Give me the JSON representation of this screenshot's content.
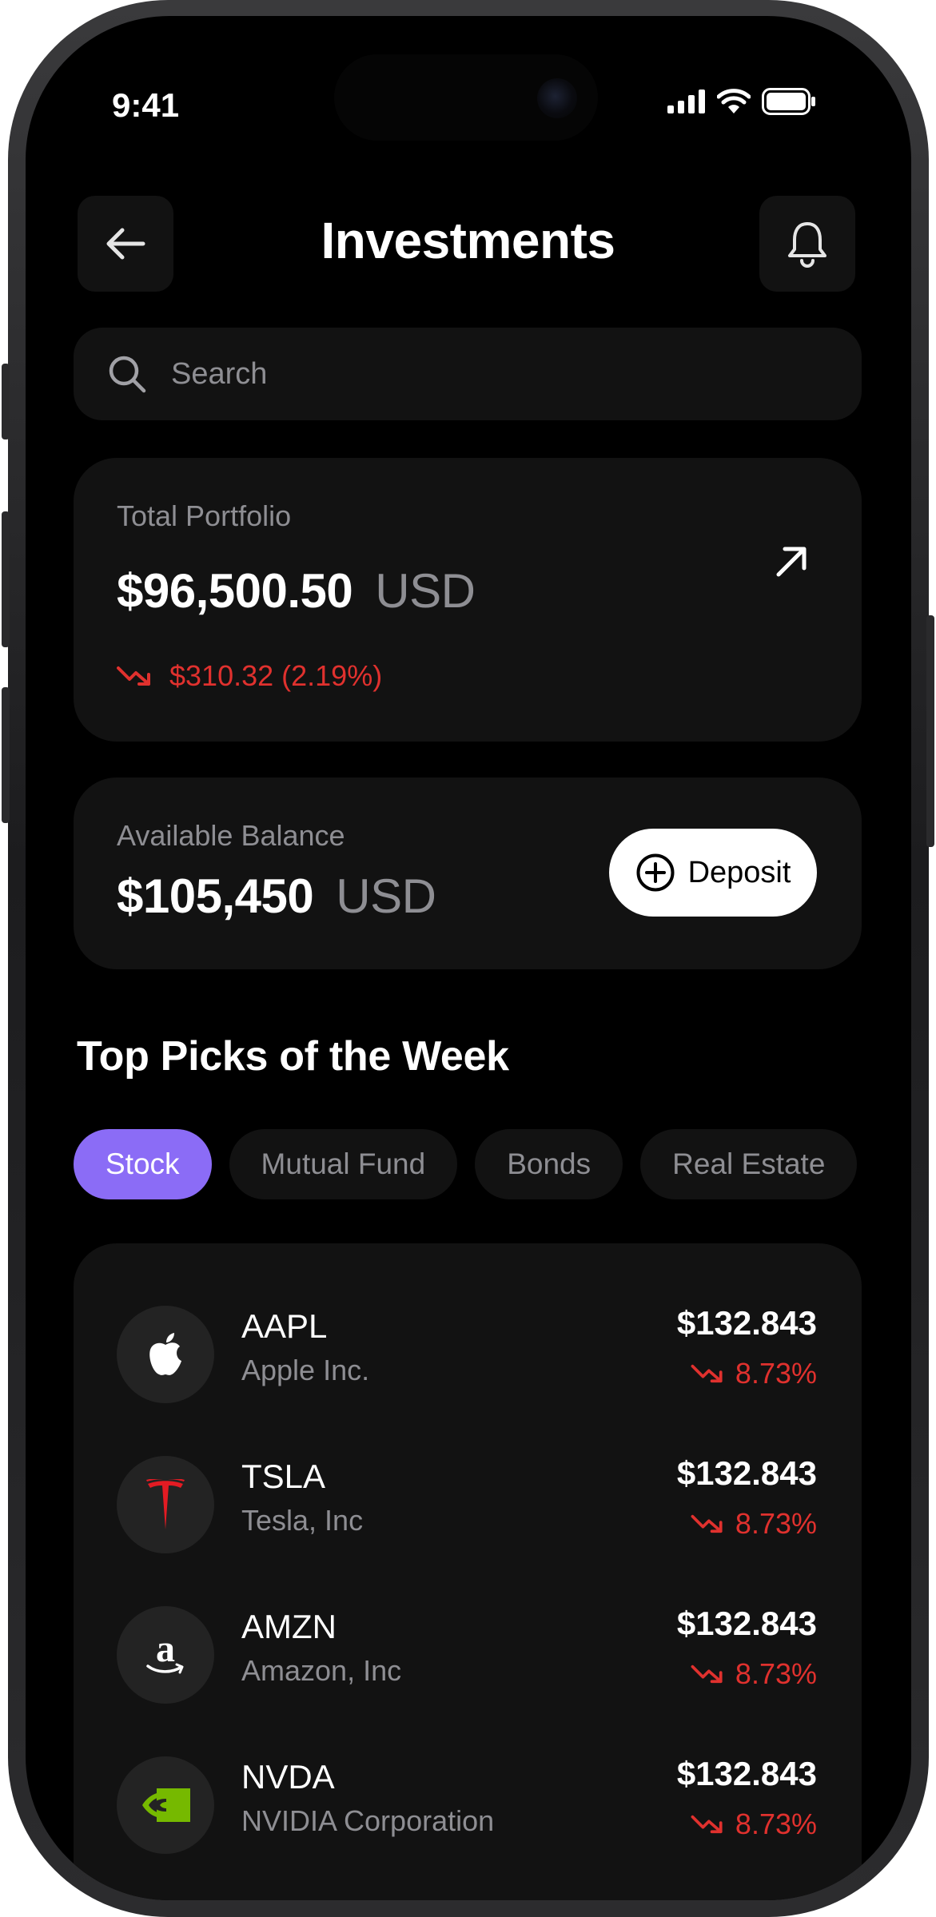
{
  "status": {
    "time": "9:41"
  },
  "header": {
    "title": "Investments"
  },
  "search": {
    "placeholder": "Search"
  },
  "portfolio": {
    "label": "Total Portfolio",
    "amount": "$96,500.50",
    "currency": "USD",
    "change": "$310.32 (2.19%)"
  },
  "balance": {
    "label": "Available Balance",
    "amount": "$105,450",
    "currency": "USD",
    "deposit_label": "Deposit"
  },
  "top_picks": {
    "title": "Top Picks of the Week",
    "tabs": [
      {
        "label": "Stock",
        "active": true
      },
      {
        "label": "Mutual Fund",
        "active": false
      },
      {
        "label": "Bonds",
        "active": false
      },
      {
        "label": "Real Estate",
        "active": false
      }
    ],
    "stocks": [
      {
        "ticker": "AAPL",
        "name": "Apple Inc.",
        "price": "$132.843",
        "change": "8.73%",
        "icon": "apple-logo-icon"
      },
      {
        "ticker": "TSLA",
        "name": "Tesla, Inc",
        "price": "$132.843",
        "change": "8.73%",
        "icon": "tesla-logo-icon"
      },
      {
        "ticker": "AMZN",
        "name": "Amazon, Inc",
        "price": "$132.843",
        "change": "8.73%",
        "icon": "amazon-logo-icon"
      },
      {
        "ticker": "NVDA",
        "name": "NVIDIA Corporation",
        "price": "$132.843",
        "change": "8.73%",
        "icon": "nvidia-logo-icon"
      }
    ]
  },
  "colors": {
    "background": "#000000",
    "card": "#121212",
    "accent": "#8b6cf6",
    "negative": "#e0312e",
    "muted": "#8e8e93"
  }
}
